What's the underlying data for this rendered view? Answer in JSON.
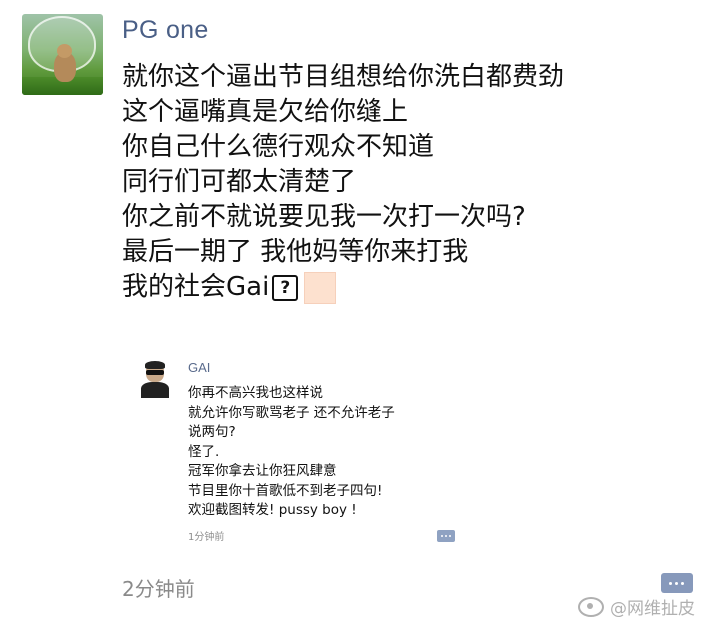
{
  "post": {
    "author": "PG one",
    "lines": [
      "就你这个逼出节目组想给你洗白都费劲",
      "这个逼嘴真是欠给你缝上",
      "你自己什么德行观众不知道",
      "同行们可都太清楚了",
      "你之前不就说要见我一次打一次吗?",
      "最后一期了 我他妈等你来打我",
      "我的社会Gai"
    ],
    "broken_emoji_glyph": "?",
    "time": "2分钟前"
  },
  "embedded": {
    "author": "GAI",
    "lines": [
      "你再不高兴我也这样说",
      "就允许你写歌骂老子 还不允许老子",
      "说两句?",
      "怪了.",
      "冠军你拿去让你狂风肆意",
      "节目里你十首歌低不到老子四句!",
      "欢迎截图转发! pussy boy !"
    ],
    "time": "1分钟前"
  },
  "watermark": {
    "text": "@网维扯皮"
  },
  "colors": {
    "username": "#4a5f86",
    "time": "#8a8a8a",
    "comment_icon": "#8799bb",
    "peach_box": "#fde1cf"
  },
  "icons": {
    "post_comment": "comment-icon",
    "embedded_comment": "comment-icon",
    "watermark_logo": "weibo-logo-icon"
  }
}
